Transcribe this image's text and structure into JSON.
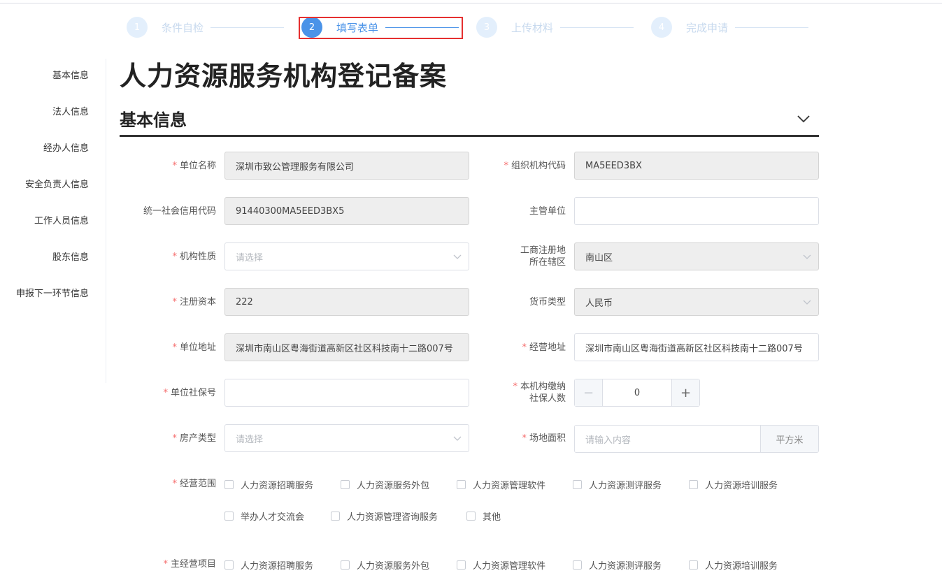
{
  "steps": [
    {
      "num": "1",
      "label": "条件自检"
    },
    {
      "num": "2",
      "label": "填写表单"
    },
    {
      "num": "3",
      "label": "上传材料"
    },
    {
      "num": "4",
      "label": "完成申请"
    }
  ],
  "sidenav": [
    "基本信息",
    "法人信息",
    "经办人信息",
    "安全负责人信息",
    "工作人员信息",
    "股东信息",
    "申报下一环节信息"
  ],
  "page_title": "人力资源服务机构登记备案",
  "section_title": "基本信息",
  "required_mark": "*",
  "form": {
    "unit_name": {
      "label": "单位名称",
      "value": "深圳市致公管理服务有限公司"
    },
    "org_code": {
      "label": "组织机构代码",
      "value": "MA5EED3BX"
    },
    "credit_code": {
      "label": "统一社会信用代码",
      "value": "91440300MA5EED3BX5"
    },
    "supervisor": {
      "label": "主管单位",
      "value": ""
    },
    "org_nature": {
      "label": "机构性质",
      "placeholder": "请选择"
    },
    "district": {
      "label_line1": "工商注册地",
      "label_line2": "所在辖区",
      "value": "南山区"
    },
    "capital": {
      "label": "注册资本",
      "value": "222"
    },
    "currency": {
      "label": "货币类型",
      "value": "人民币"
    },
    "unit_address": {
      "label": "单位地址",
      "value": "深圳市南山区粤海街道高新区社区科技南十二路007号"
    },
    "biz_address": {
      "label": "经营地址",
      "value": "深圳市南山区粤海街道高新区社区科技南十二路007号"
    },
    "social_no": {
      "label": "单位社保号",
      "value": ""
    },
    "insured_count": {
      "label_line1": "本机构缴纳",
      "label_line2": "社保人数",
      "value": "0",
      "minus": "−",
      "plus": "+"
    },
    "property_type": {
      "label": "房产类型",
      "placeholder": "请选择"
    },
    "area": {
      "label": "场地面积",
      "placeholder": "请输入内容",
      "unit": "平方米"
    },
    "scope": {
      "label": "经营范围",
      "options": [
        "人力资源招聘服务",
        "人力资源服务外包",
        "人力资源管理软件",
        "人力资源测评服务",
        "人力资源培训服务",
        "举办人才交流会",
        "人力资源管理咨询服务",
        "其他"
      ]
    },
    "main_items": {
      "label": "主经营项目",
      "options": [
        "人力资源招聘服务",
        "人力资源服务外包",
        "人力资源管理软件",
        "人力资源测评服务",
        "人力资源培训服务"
      ]
    }
  }
}
